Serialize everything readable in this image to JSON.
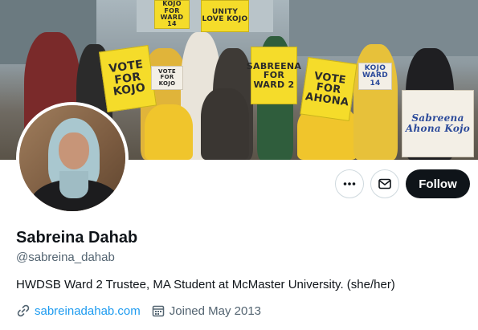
{
  "banner": {
    "signs": [
      {
        "text": "VOTE FOR KOJO",
        "style": "yellow"
      },
      {
        "text": "UNITY LOVE KOJO",
        "style": "yellow"
      },
      {
        "text": "KOJO FOR WARD 14",
        "style": "yellow"
      },
      {
        "text": "VOTE FOR KOJO",
        "style": "white"
      },
      {
        "text": "SABREENA FOR WARD 2",
        "style": "yellow"
      },
      {
        "text": "VOTE FOR AHONA",
        "style": "yellow"
      },
      {
        "text": "KOJO WARD 14",
        "style": "white"
      },
      {
        "text": "Sabreena Ahona Kojo",
        "style": "white"
      }
    ]
  },
  "profile": {
    "name": "Sabreina Dahab",
    "handle": "@sabreina_dahab",
    "bio": "HWDSB Ward 2 Trustee,  MA Student at McMaster University. (she/her)",
    "website": "sabreinadahab.com",
    "joined": "Joined May 2013"
  },
  "actions": {
    "follow_label": "Follow"
  },
  "colors": {
    "accent": "#1d9bf0",
    "follow_bg": "#0f1419",
    "muted": "#536471"
  },
  "icons": {
    "more": "more-icon",
    "message": "mail-icon",
    "link": "link-icon",
    "calendar": "calendar-icon"
  }
}
